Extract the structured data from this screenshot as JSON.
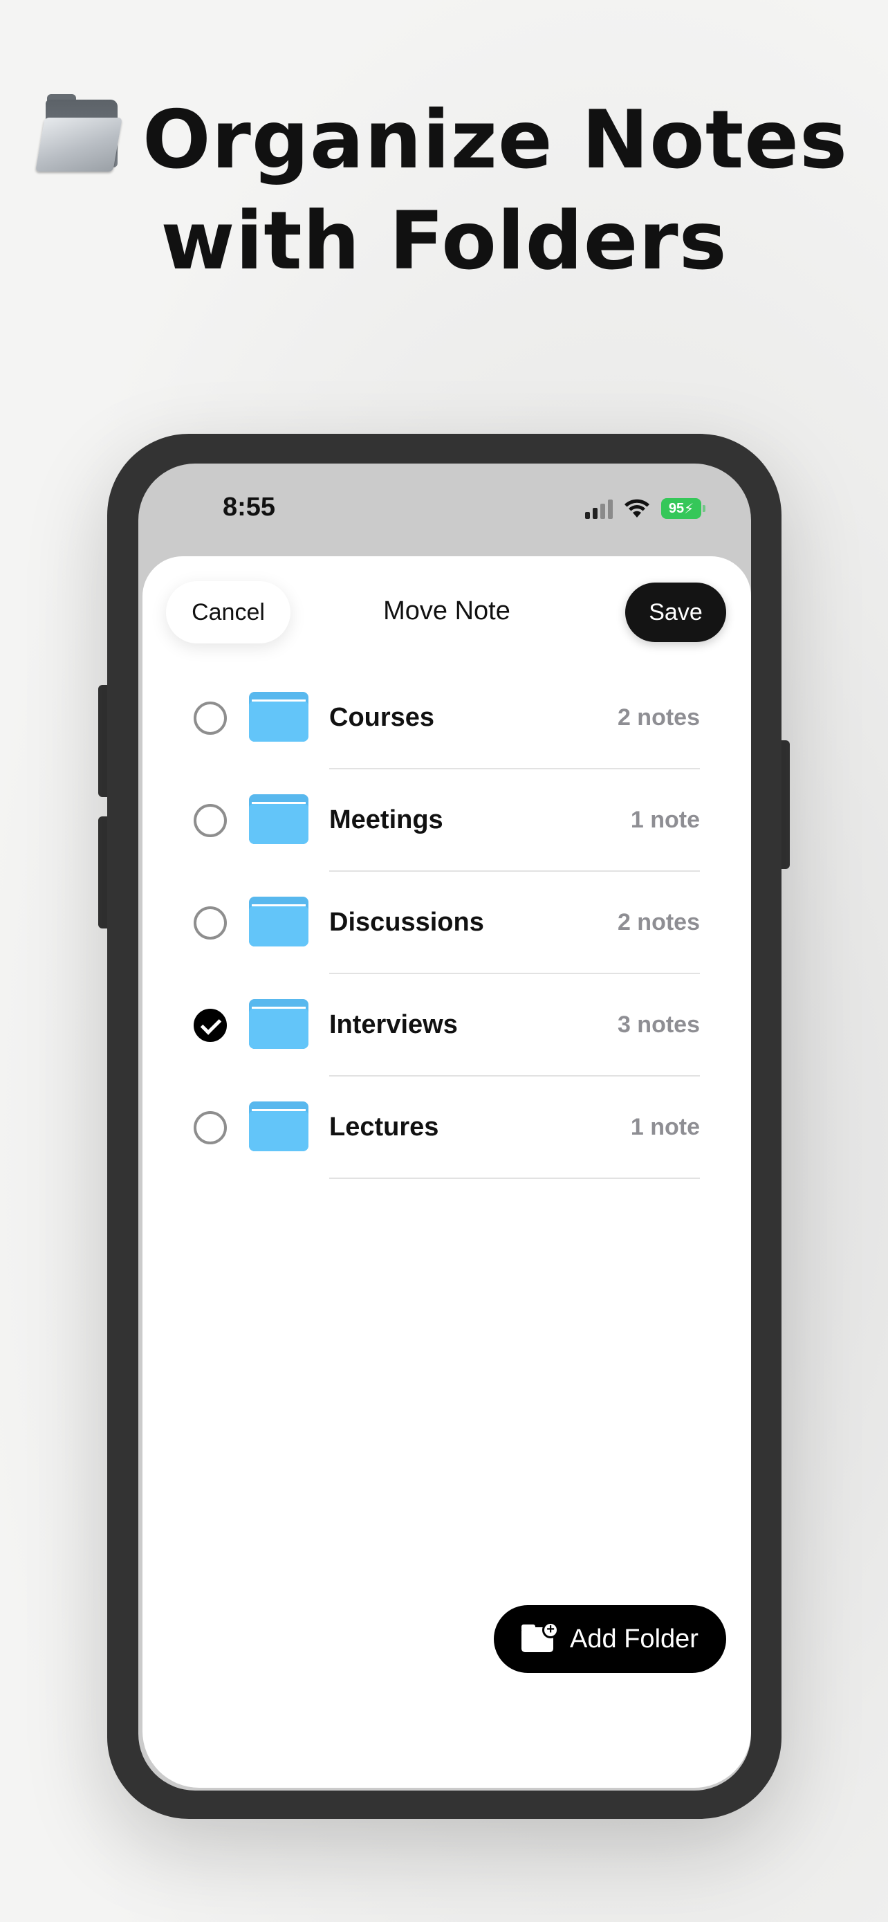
{
  "headline": {
    "line1": "Organize Notes",
    "line2": "with Folders",
    "emoji": "open-file-folder-icon"
  },
  "status_bar": {
    "time": "8:55",
    "battery": "95",
    "icons": [
      "signal-icon",
      "wifi-icon",
      "battery-charging-icon"
    ],
    "battery_color": "#35c759"
  },
  "sheet": {
    "cancel_label": "Cancel",
    "title": "Move Note",
    "save_label": "Save"
  },
  "folders": [
    {
      "name": "Courses",
      "count": "2 notes",
      "selected": false
    },
    {
      "name": "Meetings",
      "count": "1 note",
      "selected": false
    },
    {
      "name": "Discussions",
      "count": "2 notes",
      "selected": false
    },
    {
      "name": "Interviews",
      "count": "3 notes",
      "selected": true
    },
    {
      "name": "Lectures",
      "count": "1 note",
      "selected": false
    }
  ],
  "add_folder": {
    "label": "Add Folder",
    "icon": "folder-plus-icon"
  },
  "colors": {
    "folder": "#63c5f9",
    "accent": "#000000"
  }
}
